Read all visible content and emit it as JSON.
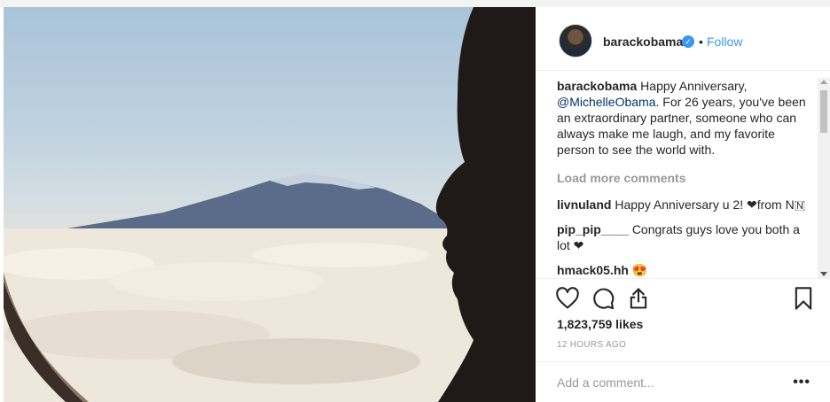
{
  "post": {
    "author": "barackobama",
    "follow_label": "Follow",
    "separator": "•",
    "caption_user": "barackobama",
    "caption_pre": "Happy Anniversary, ",
    "caption_mention": "@MichelleObama",
    "caption_post": ". For 26 years, you've been an extraordinary partner, someone who can always make me laugh, and my favorite person to see the world with.",
    "load_more": "Load more comments",
    "comments": [
      {
        "user": "livnuland",
        "text": "Happy Anniversary u 2! ❤from N🇳"
      },
      {
        "user": "pip_pip____",
        "text": "Congrats guys love you both a lot ❤"
      },
      {
        "user": "hmack05.hh",
        "text": "😍"
      }
    ],
    "likes": "1,823,759 likes",
    "time": "12 HOURS AGO",
    "add_comment_placeholder": "Add a comment...",
    "more_options": "•••"
  },
  "icons": {
    "like": "heart-icon",
    "comment": "comment-icon",
    "share": "share-icon",
    "save": "bookmark-icon",
    "verified": "verified-badge-icon"
  },
  "colors": {
    "link": "#3897f0",
    "mention": "#003569",
    "muted": "#999999"
  }
}
